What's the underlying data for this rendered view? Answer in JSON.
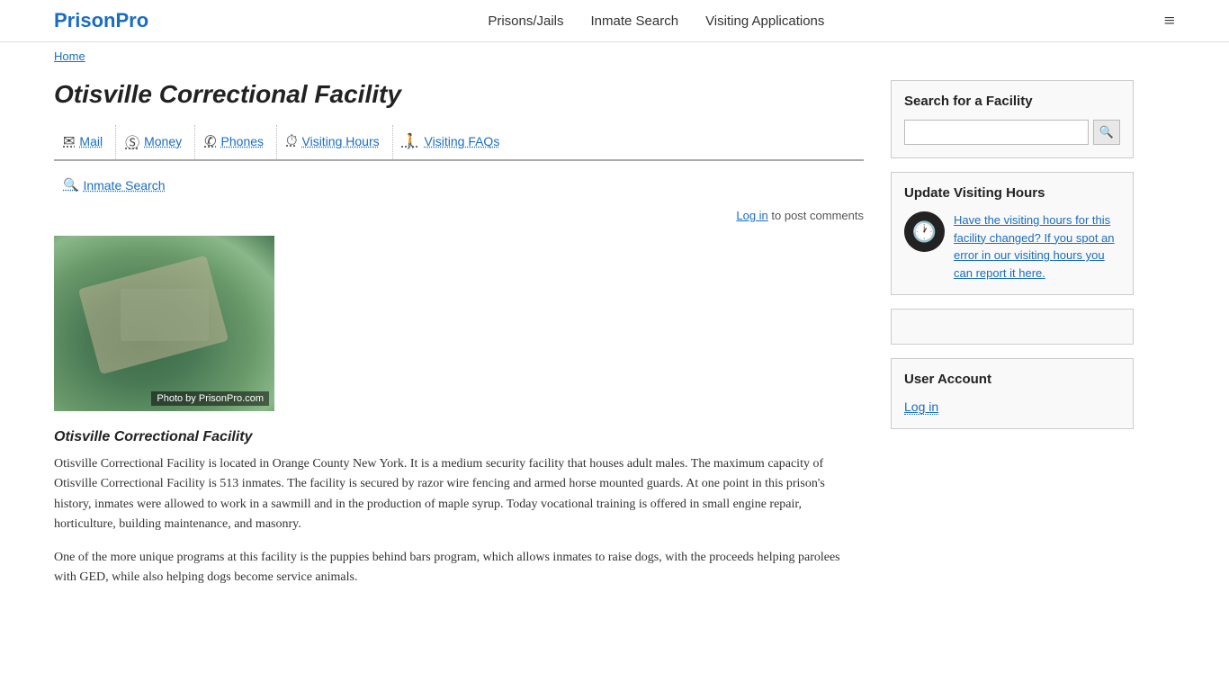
{
  "header": {
    "logo": "PrisonPro",
    "nav": {
      "item1": "Prisons/Jails",
      "item2": "Inmate Search",
      "item3": "Visiting Applications"
    },
    "hamburger_icon": "≡"
  },
  "breadcrumb": {
    "home_label": "Home"
  },
  "facility": {
    "title": "Otisville Correctional Facility",
    "subtitle": "Otisville Correctional Facility",
    "photo_credit": "Photo by PrisonPro.com",
    "description_p1": "Otisville Correctional Facility is located in Orange County New York.  It is a medium security facility that houses adult males.   The maximum capacity of Otisville Correctional Facility is 513 inmates.   The facility is secured by razor wire fencing and armed horse mounted guards.  At one point in this prison's history, inmates were allowed to work in a sawmill and in the production of maple syrup.  Today vocational training is offered in small engine repair, horticulture, building maintenance, and masonry.",
    "description_p2": "One of the more unique programs at this facility is the puppies behind bars program, which allows inmates to raise dogs, with the proceeds helping parolees with GED, while also helping dogs become service animals."
  },
  "tabs": [
    {
      "id": "mail",
      "icon": "✉",
      "label": "Mail"
    },
    {
      "id": "money",
      "icon": "Ⓢ",
      "label": "Money"
    },
    {
      "id": "phones",
      "icon": "✆",
      "label": "Phones"
    },
    {
      "id": "visiting-hours",
      "icon": "⏱",
      "label": "Visiting Hours"
    },
    {
      "id": "visiting-faqs",
      "icon": "🚶",
      "label": "Visiting FAQs"
    }
  ],
  "inmate_search_tab": {
    "icon": "🔍",
    "label": "Inmate Search"
  },
  "login_line": {
    "prefix": "Log in",
    "suffix": " to post comments"
  },
  "sidebar": {
    "search_box": {
      "title": "Search for a Facility",
      "input_placeholder": "",
      "search_btn_icon": "🔍"
    },
    "update_visiting": {
      "title": "Update Visiting Hours",
      "clock_icon": "🕐",
      "text_link": "Have the visiting hours for this facility changed?  If you spot an error in our visiting hours you can report it here."
    },
    "user_account": {
      "title": "User Account",
      "login_label": "Log in"
    }
  }
}
